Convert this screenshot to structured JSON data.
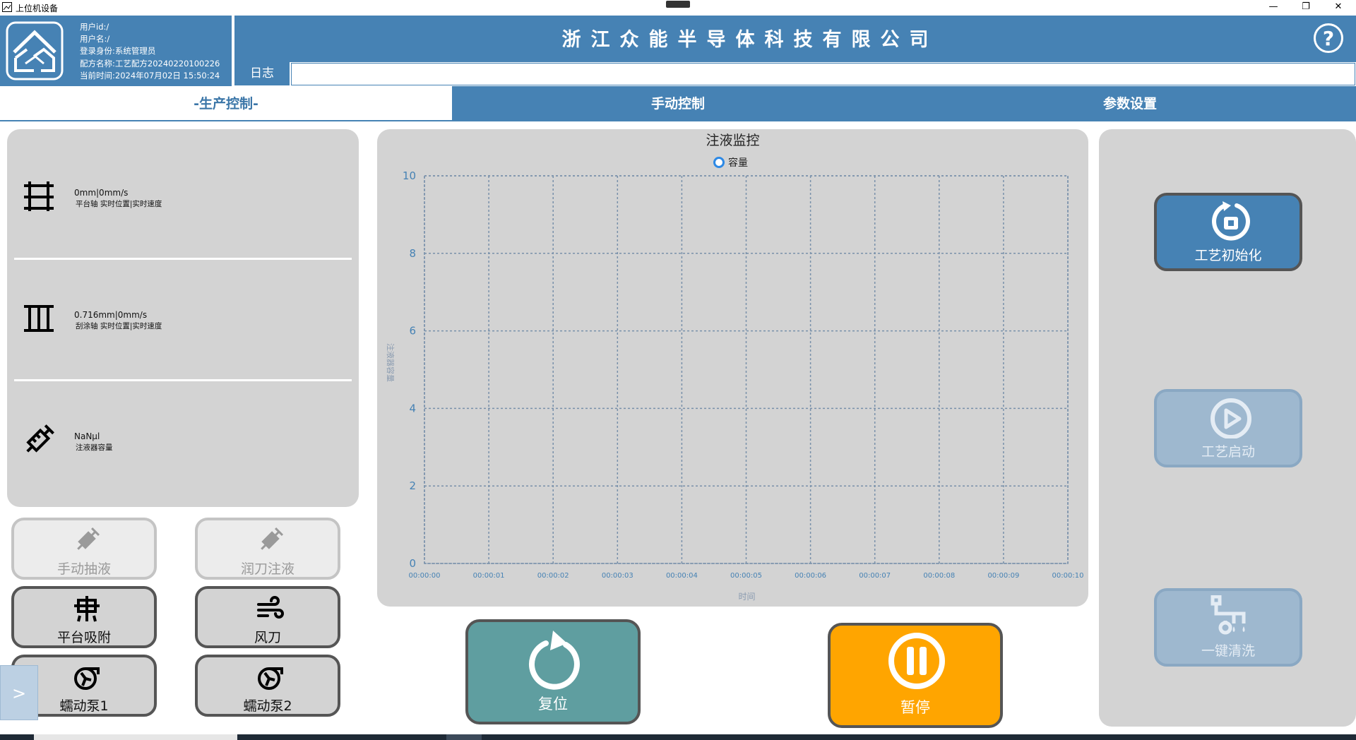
{
  "window": {
    "title": "上位机设备",
    "minimize": "—",
    "restore": "❐",
    "close": "✕"
  },
  "header": {
    "user_info": [
      "用户id:/",
      "用户名:/",
      "登录身份:系统管理员",
      "配方名称:工艺配方20240220100226",
      "当前时间:2024年07月02日 15:50:24"
    ],
    "company_name": "浙江众能半导体科技有限公司",
    "help": "?",
    "log_label": "日志",
    "log_value": ""
  },
  "tabs": [
    {
      "label": "-生产控制-",
      "active": true
    },
    {
      "label": "手动控制",
      "active": false
    },
    {
      "label": "参数设置",
      "active": false
    }
  ],
  "axes": [
    {
      "icon": "platform-axis-icon",
      "value": "0mm|0mm/s",
      "desc": "平台轴 实时位置|实时速度"
    },
    {
      "icon": "scraper-axis-icon",
      "value": "0.716mm|0mm/s",
      "desc": "刮涂轴 实时位置|实时速度"
    },
    {
      "icon": "syringe-icon",
      "value": "NaNμl",
      "desc": "注液器容量"
    }
  ],
  "left_buttons": [
    {
      "label": "手动抽液",
      "icon": "syringe-icon",
      "enabled": false
    },
    {
      "label": "润刀注液",
      "icon": "syringe-icon",
      "enabled": false
    },
    {
      "label": "平台吸附",
      "icon": "suction-icon",
      "enabled": true
    },
    {
      "label": "风刀",
      "icon": "wind-icon",
      "enabled": true
    },
    {
      "label": "蠕动泵1",
      "icon": "pump-icon",
      "enabled": true
    },
    {
      "label": "蠕动泵2",
      "icon": "pump-icon",
      "enabled": true
    }
  ],
  "side_toggle": ">",
  "chart_data": {
    "type": "line",
    "title": "注液监控",
    "series": [
      {
        "name": "容量",
        "values": []
      }
    ],
    "x": [
      "00:00:00",
      "00:00:01",
      "00:00:02",
      "00:00:03",
      "00:00:04",
      "00:00:05",
      "00:00:06",
      "00:00:07",
      "00:00:08",
      "00:00:09",
      "00:00:10"
    ],
    "y_ticks": [
      0,
      2,
      4,
      6,
      8,
      10
    ],
    "ylim": [
      0,
      10
    ],
    "xlabel": "时间",
    "ylabel": "注液器容量",
    "grid": true,
    "legend": "top-center",
    "colors": {
      "grid": "#7890aa",
      "axis_label": "#4682b4",
      "legend": "#2d89e5"
    }
  },
  "bottom_buttons": {
    "reset": {
      "label": "复位",
      "color": "#5f9ea0"
    },
    "pause": {
      "label": "暂停",
      "color": "#ffa500"
    }
  },
  "right_buttons": [
    {
      "label": "工艺初始化",
      "icon": "init-icon",
      "enabled": true
    },
    {
      "label": "工艺启动",
      "icon": "play-icon",
      "enabled": false
    },
    {
      "label": "一键清洗",
      "icon": "pipe-clean-icon",
      "enabled": false
    }
  ],
  "colors": {
    "brand": "#4682b4",
    "panel": "#d3d3d3",
    "disabled_blue": "#9eb8cf"
  }
}
